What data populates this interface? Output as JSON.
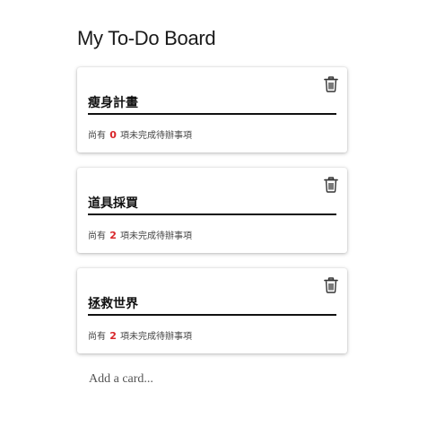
{
  "board": {
    "title": "My To-Do Board",
    "add_card_label": "Add a card..."
  },
  "cards": [
    {
      "title": "瘦身計畫",
      "status_prefix": "尚有",
      "remaining": "0",
      "status_suffix": "項未完成待辦事項",
      "delete_icon": "trash-icon"
    },
    {
      "title": "道具採買",
      "status_prefix": "尚有",
      "remaining": "2",
      "status_suffix": "項未完成待辦事項",
      "delete_icon": "trash-icon"
    },
    {
      "title": "拯救世界",
      "status_prefix": "尚有",
      "remaining": "2",
      "status_suffix": "項未完成待辦事項",
      "delete_icon": "trash-icon"
    }
  ],
  "colors": {
    "count_highlight": "#d9262a",
    "title_underline": "#111111"
  }
}
